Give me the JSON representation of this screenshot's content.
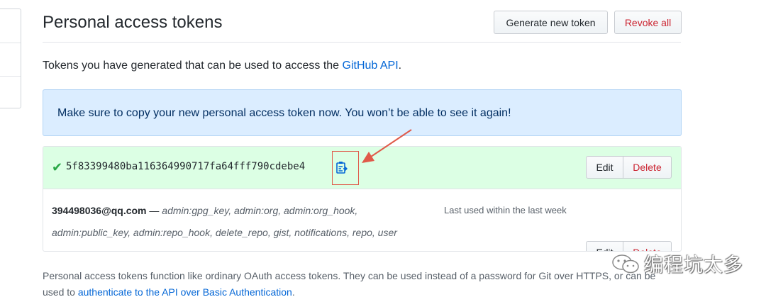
{
  "header": {
    "title": "Personal access tokens",
    "generate_label": "Generate new token",
    "revoke_label": "Revoke all"
  },
  "intro": {
    "prefix": "Tokens you have generated that can be used to access the ",
    "link": "GitHub API",
    "suffix": "."
  },
  "flash": {
    "message": "Make sure to copy your new personal access token now. You won’t be able to see it again!"
  },
  "tokens": [
    {
      "value": "5f83399480ba116364990717fa64fff790cdebe4",
      "edit_label": "Edit",
      "delete_label": "Delete"
    },
    {
      "owner": "394498036@qq.com",
      "separator": " —",
      "scopes_line1": "admin:gpg_key, admin:org, admin:org_hook,",
      "scopes_line2": "admin:public_key, admin:repo_hook, delete_repo, gist, notifications, repo, user",
      "last_used": "Last used within the last week",
      "edit_label": "Edit",
      "delete_label": "Delete"
    }
  ],
  "footer": {
    "line1": "Personal access tokens function like ordinary OAuth access tokens. They can be used instead of a password for Git over HTTPS, or can be",
    "line2_prefix": "used to ",
    "line2_link": "authenticate to the API over Basic Authentication",
    "line2_suffix": "."
  },
  "watermark": {
    "text": "编程坑太多"
  },
  "colors": {
    "link": "#0366d6",
    "danger": "#cb2431",
    "success": "#28a745",
    "flash_bg": "#dbedff",
    "new_token_bg": "#dcffe4",
    "annotation": "#e05a4a"
  }
}
